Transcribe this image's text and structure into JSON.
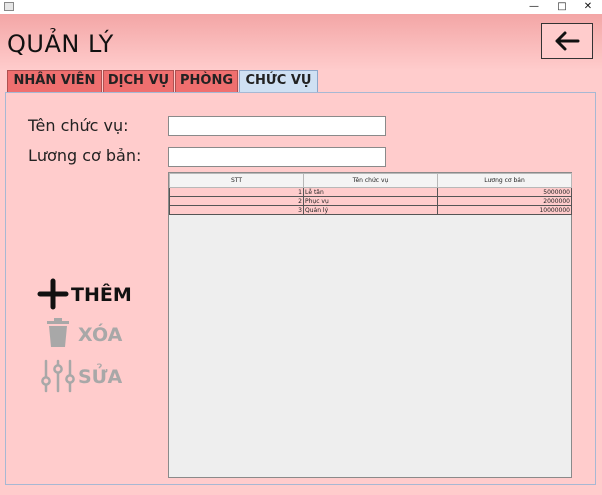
{
  "window": {
    "minimize_glyph": "—",
    "maximize_glyph": "□",
    "close_glyph": "✕"
  },
  "header": {
    "title": "QUẢN LÝ",
    "back_icon": "arrow-left-icon"
  },
  "tabs": [
    {
      "label": "NHÂN VIÊN",
      "active": false
    },
    {
      "label": "DỊCH VỤ",
      "active": false
    },
    {
      "label": "PHÒNG",
      "active": false
    },
    {
      "label": "CHỨC VỤ",
      "active": true
    }
  ],
  "form": {
    "position_name_label": "Tên chức vụ:",
    "position_name_value": "",
    "base_salary_label": "Lương cơ bản:",
    "base_salary_value": ""
  },
  "table": {
    "columns": [
      "STT",
      "Tên chức vụ",
      "Lương cơ bản"
    ],
    "rows": [
      [
        "1",
        "Lễ tân",
        "5000000"
      ],
      [
        "2",
        "Phục vụ",
        "2000000"
      ],
      [
        "3",
        "Quản lý",
        "10000000"
      ]
    ]
  },
  "actions": [
    {
      "label": "THÊM",
      "icon": "plus-icon",
      "enabled": true
    },
    {
      "label": "XÓA",
      "icon": "trash-icon",
      "enabled": false
    },
    {
      "label": "SỬA",
      "icon": "sliders-icon",
      "enabled": false
    }
  ],
  "colors": {
    "background": "#ffcccc",
    "tab_inactive": "#ef6f6f",
    "tab_active": "#cfe0f3",
    "disabled_text": "#a8a8a8"
  }
}
